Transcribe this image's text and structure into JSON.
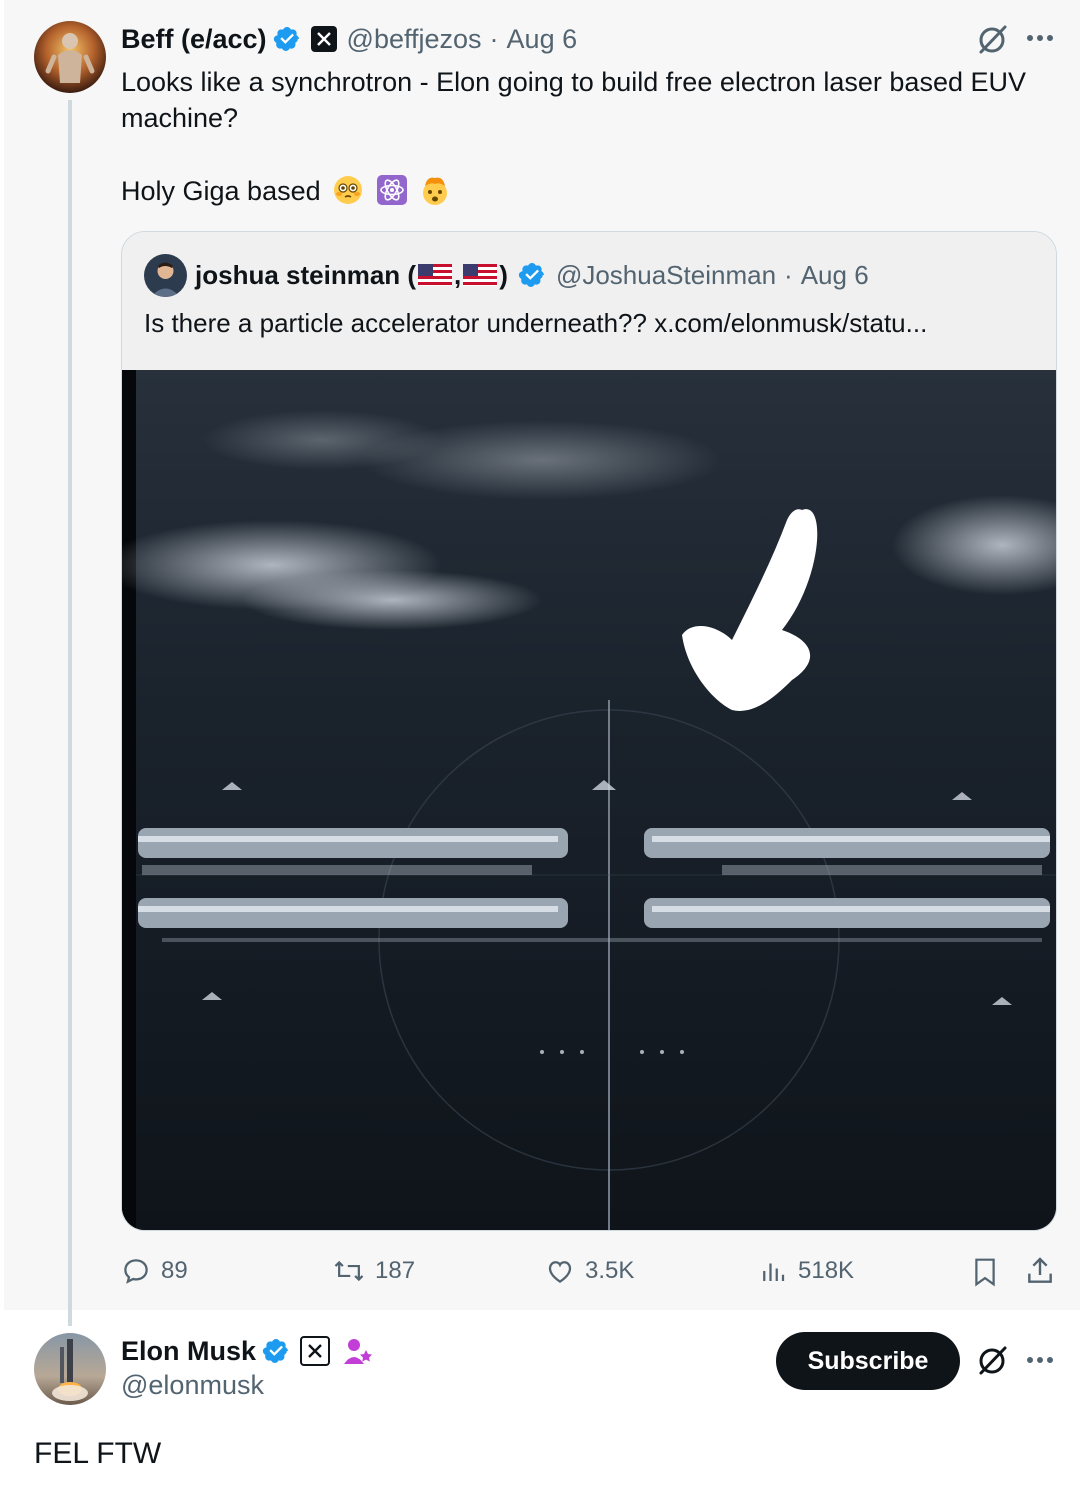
{
  "main_tweet": {
    "display_name": "Beff (e/acc)",
    "handle": "@beffjezos",
    "separator": "·",
    "date": "Aug 6",
    "text_line1": "Looks like a synchrotron - Elon going to build free electron laser based EUV",
    "text_line2": "machine?",
    "text_line3": "Holy Giga based",
    "emojis": [
      "flushed-face",
      "atom-symbol",
      "exploding-head"
    ],
    "avatar": "muscular-figure-avatar"
  },
  "quoted_tweet": {
    "display_name": "joshua steinman (",
    "flag_sep": ",",
    "close_paren": ")",
    "handle": "@JoshuaSteinman",
    "separator": "·",
    "date": "Aug 6",
    "text": "Is there a particle accelerator underneath??  x.com/elonmusk/statu...",
    "media_description_icon": "white-arrow-icon"
  },
  "actions": {
    "replies": "89",
    "reposts": "187",
    "likes": "3.5K",
    "views": "518K"
  },
  "reply": {
    "display_name": "Elon Musk",
    "handle": "@elonmusk",
    "subscribe_label": "Subscribe",
    "text": "FEL FTW"
  },
  "colors": {
    "verified_blue": "#1d9bf0",
    "text_primary": "#0f1419",
    "text_secondary": "#536471",
    "thread_line": "#cfd9de",
    "affiliate_purple": "#c13fd6"
  }
}
